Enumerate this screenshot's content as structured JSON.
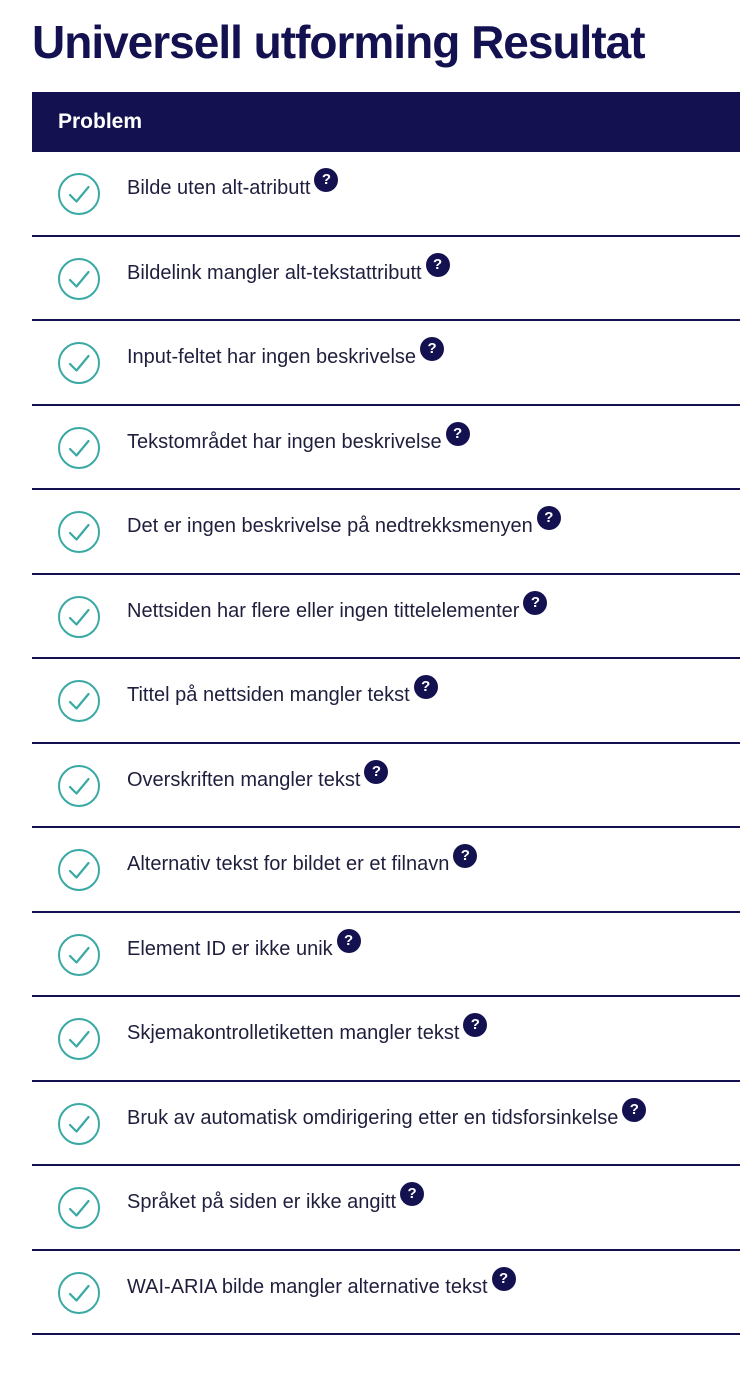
{
  "page": {
    "title": "Universell utforming Resultat"
  },
  "table": {
    "header": "Problem",
    "status_color": "#3aa9a4",
    "header_color": "#131150",
    "help_icon_glyph": "?",
    "rows": [
      {
        "label": "Bilde uten alt-atributt",
        "status": "passed",
        "icon": "check-circle-icon"
      },
      {
        "label": "Bildelink mangler alt-tekstattributt",
        "status": "passed",
        "icon": "check-circle-icon"
      },
      {
        "label": "Input-feltet har ingen beskrivelse",
        "status": "passed",
        "icon": "check-circle-icon"
      },
      {
        "label": "Tekstområdet har ingen beskrivelse",
        "status": "passed",
        "icon": "check-circle-icon"
      },
      {
        "label": "Det er ingen beskrivelse på nedtrekksmenyen",
        "status": "passed",
        "icon": "check-circle-icon"
      },
      {
        "label": "Nettsiden har flere eller ingen tittelelementer",
        "status": "passed",
        "icon": "check-circle-icon"
      },
      {
        "label": "Tittel på nettsiden mangler tekst",
        "status": "passed",
        "icon": "check-circle-icon"
      },
      {
        "label": "Overskriften mangler tekst",
        "status": "passed",
        "icon": "check-circle-icon"
      },
      {
        "label": "Alternativ tekst for bildet er et filnavn",
        "status": "passed",
        "icon": "check-circle-icon"
      },
      {
        "label": "Element ID er ikke unik",
        "status": "passed",
        "icon": "check-circle-icon"
      },
      {
        "label": "Skjemakontrolletiketten mangler tekst",
        "status": "passed",
        "icon": "check-circle-icon"
      },
      {
        "label": "Bruk av automatisk omdirigering etter en tidsforsinkelse",
        "status": "passed",
        "icon": "check-circle-icon"
      },
      {
        "label": "Språket på siden er ikke angitt",
        "status": "passed",
        "icon": "check-circle-icon"
      },
      {
        "label": "WAI-ARIA bilde mangler alternative tekst",
        "status": "passed",
        "icon": "check-circle-icon"
      }
    ]
  }
}
